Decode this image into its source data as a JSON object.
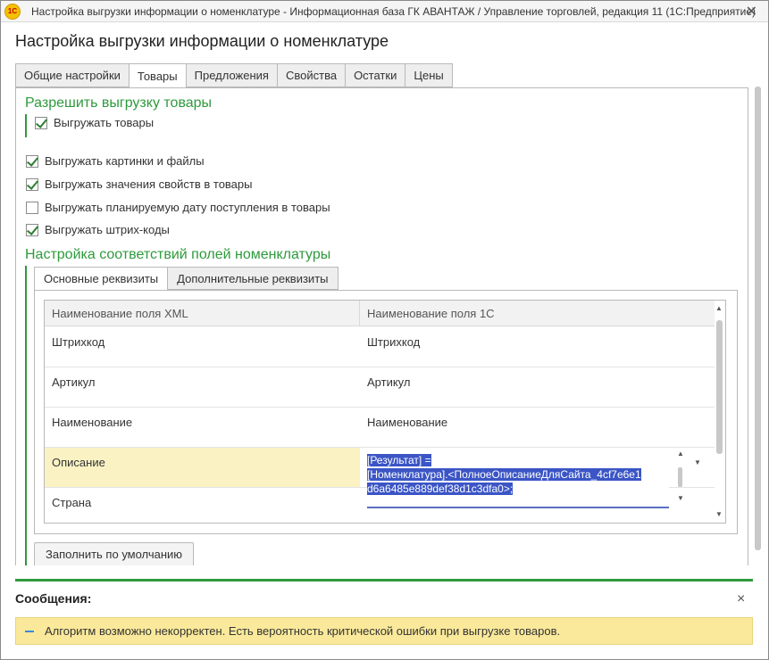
{
  "window": {
    "title": "Настройка выгрузки информации о номенклатуре - Информационная база ГК АВАНТАЖ / Управление торговлей, редакция 11  (1С:Предприятие)",
    "icon_label": "1С",
    "close_glyph": "✕"
  },
  "form": {
    "title": "Настройка выгрузки информации о номенклатуре"
  },
  "tabs": [
    {
      "label": "Общие настройки"
    },
    {
      "label": "Товары"
    },
    {
      "label": "Предложения"
    },
    {
      "label": "Свойства"
    },
    {
      "label": "Остатки"
    },
    {
      "label": "Цены"
    }
  ],
  "active_tab": "Товары",
  "allow_section": {
    "title": "Разрешить выгрузку товары",
    "checkbox_label": "Выгружать товары",
    "checked": true
  },
  "options": [
    {
      "label": "Выгружать картинки и файлы",
      "checked": true
    },
    {
      "label": "Выгружать значения свойств в товары",
      "checked": true
    },
    {
      "label": "Выгружать планируемую дату поступления в товары",
      "checked": false
    },
    {
      "label": "Выгружать штрих-коды",
      "checked": true
    }
  ],
  "mapping_section": {
    "title": "Настройка соответствий полей номенклатуры",
    "inner_tabs": [
      {
        "label": "Основные реквизиты"
      },
      {
        "label": "Дополнительные реквизиты"
      }
    ],
    "table": {
      "headers": [
        "Наименование поля XML",
        "Наименование поля 1С"
      ],
      "rows": [
        {
          "xml": "Штрихкод",
          "c1": "Штрихкод"
        },
        {
          "xml": "Артикул",
          "c1": "Артикул"
        },
        {
          "xml": "Наименование",
          "c1": "Наименование"
        },
        {
          "xml": "Описание",
          "c1_lines": [
            "[Результат] =",
            "[Номенклатура].<ПолноеОписаниеДляСайта_4cf7e6e1",
            "d6a6485e889def38d1c3dfa0>;"
          ]
        },
        {
          "xml": "Страна",
          "c1": ""
        }
      ]
    },
    "fill_default_button": "Заполнить по умолчанию"
  },
  "messages": {
    "title": "Сообщения:",
    "close_glyph": "×",
    "items": [
      {
        "text": "Алгоритм возможно некорректен. Есть вероятность критической ошибки при выгрузке товаров."
      }
    ]
  },
  "colors": {
    "accent_green": "#2e9a3c",
    "selection_blue": "#3b55c6",
    "selected_row": "#fbf2c4",
    "message_bar": "#fae99a"
  }
}
